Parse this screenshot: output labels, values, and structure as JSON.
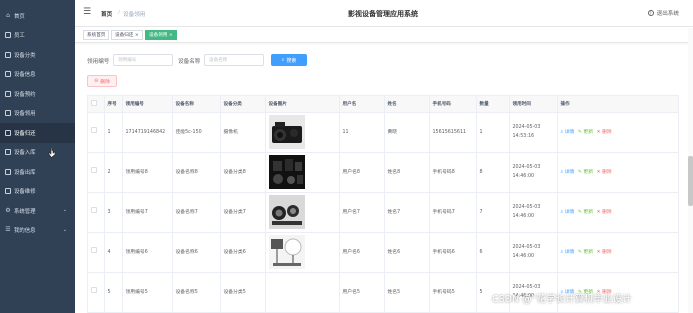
{
  "sidebar": {
    "items": [
      {
        "label": "首页",
        "icon": "home-icon"
      },
      {
        "label": "员工",
        "icon": "menu-grid-icon"
      },
      {
        "label": "设备分类",
        "icon": "menu-grid-icon"
      },
      {
        "label": "设备信息",
        "icon": "menu-grid-icon"
      },
      {
        "label": "设备预约",
        "icon": "menu-grid-icon"
      },
      {
        "label": "设备领用",
        "icon": "menu-grid-icon"
      },
      {
        "label": "设备归还",
        "icon": "menu-grid-icon"
      },
      {
        "label": "设备入库",
        "icon": "menu-grid-icon"
      },
      {
        "label": "设备出库",
        "icon": "menu-grid-icon"
      },
      {
        "label": "设备维修",
        "icon": "menu-grid-icon"
      },
      {
        "label": "系统管理",
        "icon": "gear-icon"
      },
      {
        "label": "我的信息",
        "icon": "user-icon"
      }
    ],
    "active_index": 6
  },
  "header": {
    "breadcrumb_home": "首页",
    "breadcrumb_sep": "/",
    "breadcrumb_current": "设备领用",
    "app_title": "影视设备管理应用系统",
    "logout_label": "退出系统"
  },
  "tags": [
    {
      "label": "系统首页"
    },
    {
      "label": "设备归还 ×"
    },
    {
      "label": "设备领用 ×"
    }
  ],
  "search": {
    "field1_label": "领用编号",
    "field1_placeholder": "领用编号",
    "field2_label": "设备名称",
    "field2_placeholder": "设备名称",
    "search_button": "搜索"
  },
  "delete_button": "删除",
  "table": {
    "columns": [
      "",
      "序号",
      "领用编号",
      "设备名称",
      "设备分类",
      "设备图片",
      "用户名",
      "姓名",
      "手机号码",
      "数量",
      "领用时间",
      "操作"
    ],
    "actions": {
      "detail": "详情",
      "edit": "更新",
      "delete": "删除"
    },
    "rows": [
      {
        "index": "1",
        "code": "1714719146842",
        "name": "佳能5c-150",
        "category": "摄像机",
        "username": "11",
        "realname": "黄晓",
        "phone": "15615615611",
        "qty": "1",
        "time": "2024-05-03 14:53:16"
      },
      {
        "index": "2",
        "code": "领用编号8",
        "name": "设备名称8",
        "category": "设备分类8",
        "username": "用户名8",
        "realname": "姓名8",
        "phone": "手机号码8",
        "qty": "8",
        "time": "2024-05-03 14:46:00"
      },
      {
        "index": "3",
        "code": "领用编号7",
        "name": "设备名称7",
        "category": "设备分类7",
        "username": "用户名7",
        "realname": "姓名7",
        "phone": "手机号码7",
        "qty": "7",
        "time": "2024-05-03 14:46:00"
      },
      {
        "index": "4",
        "code": "领用编号6",
        "name": "设备名称6",
        "category": "设备分类6",
        "username": "用户名6",
        "realname": "姓名6",
        "phone": "手机号码6",
        "qty": "6",
        "time": "2024-05-03 14:46:00"
      },
      {
        "index": "5",
        "code": "领用编号5",
        "name": "设备名称5",
        "category": "设备分类5",
        "username": "用户名5",
        "realname": "姓名5",
        "phone": "手机号码5",
        "qty": "5",
        "time": "2024-05-03 14:46:00"
      }
    ]
  },
  "watermark": "CSDN @“花学长计算机毕业设计",
  "colors": {
    "sidebar_bg": "#304156",
    "primary": "#409eff",
    "tag_active": "#42b983",
    "danger": "#f56c6c",
    "success": "#67c23a"
  }
}
